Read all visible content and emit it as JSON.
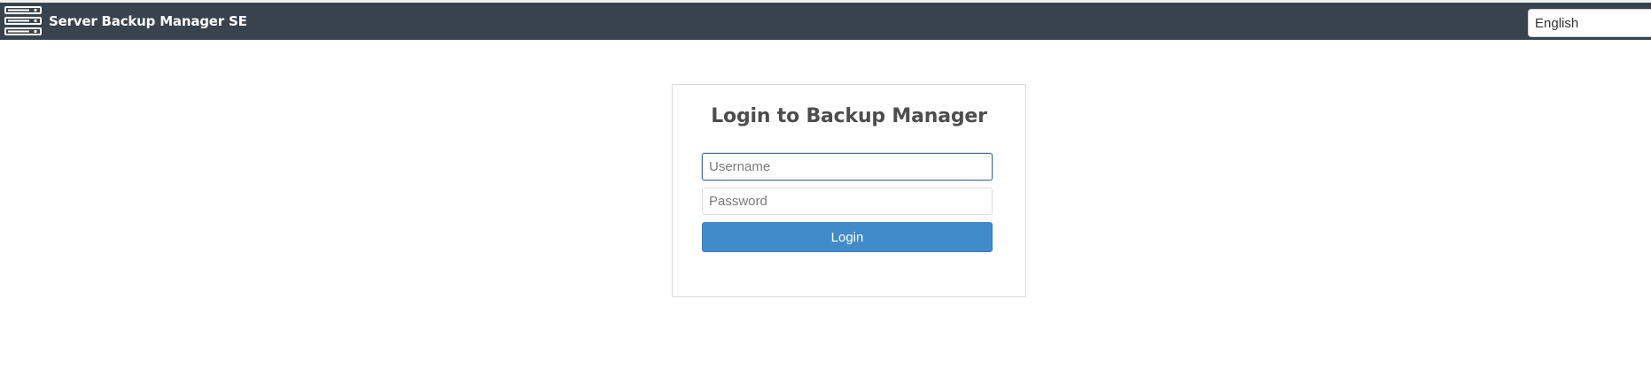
{
  "navbar": {
    "brand_title": "Server Backup Manager SE",
    "brand_icon": "server-rack-icon",
    "language_selected": "English",
    "background_color": "#38434e"
  },
  "login": {
    "title": "Login to Backup Manager",
    "username_placeholder": "Username",
    "username_value": "",
    "password_placeholder": "Password",
    "password_value": "",
    "button_label": "Login",
    "button_color": "#428bca"
  }
}
